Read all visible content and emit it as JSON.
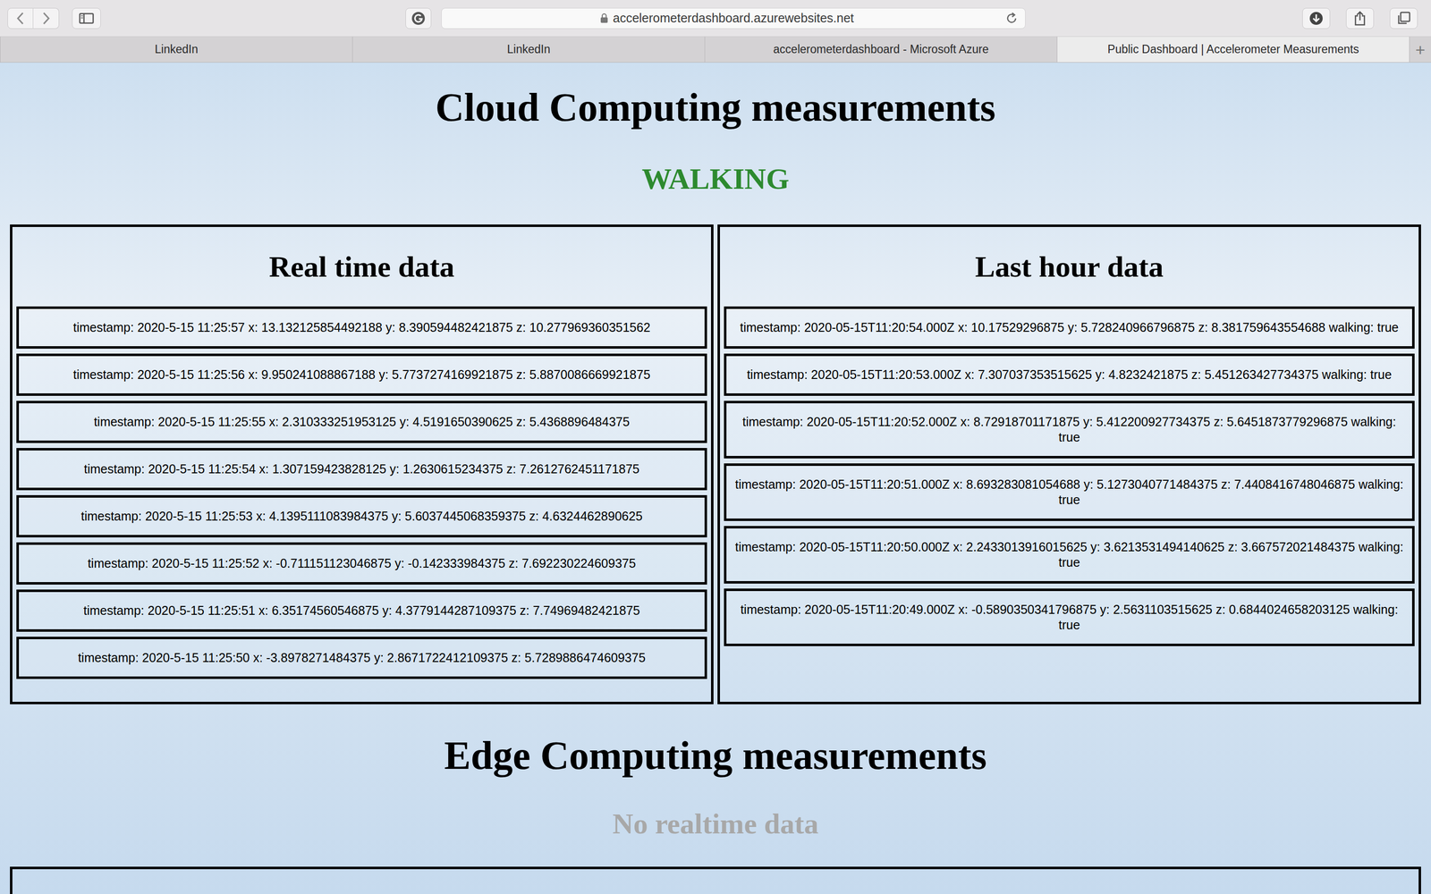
{
  "browser": {
    "address": "accelerometerdashboard.azurewebsites.net",
    "tabs": [
      {
        "label": "LinkedIn",
        "selected": false
      },
      {
        "label": "LinkedIn",
        "selected": false
      },
      {
        "label": "accelerometerdashboard - Microsoft Azure",
        "selected": false
      },
      {
        "label": "Public Dashboard | Accelerometer Measurements",
        "selected": true
      }
    ],
    "new_tab": "+"
  },
  "cloud": {
    "title": "Cloud Computing measurements",
    "status": "WALKING"
  },
  "realtime": {
    "title": "Real time data",
    "rows": [
      "timestamp: 2020-5-15 11:25:57 x: 13.132125854492188 y: 8.390594482421875 z: 10.277969360351562",
      "timestamp: 2020-5-15 11:25:56 x: 9.950241088867188 y: 5.7737274169921875 z: 5.8870086669921875",
      "timestamp: 2020-5-15 11:25:55 x: 2.310333251953125 y: 4.5191650390625 z: 5.4368896484375",
      "timestamp: 2020-5-15 11:25:54 x: 1.307159423828125 y: 1.2630615234375 z: 7.2612762451171875",
      "timestamp: 2020-5-15 11:25:53 x: 4.1395111083984375 y: 5.6037445068359375 z: 4.6324462890625",
      "timestamp: 2020-5-15 11:25:52 x: -0.711151123046875 y: -0.142333984375 z: 7.692230224609375",
      "timestamp: 2020-5-15 11:25:51 x: 6.35174560546875 y: 4.3779144287109375 z: 7.74969482421875",
      "timestamp: 2020-5-15 11:25:50 x: -3.8978271484375 y: 2.8671722412109375 z: 5.7289886474609375"
    ]
  },
  "last_hour": {
    "title": "Last hour data",
    "rows": [
      "timestamp: 2020-05-15T11:20:54.000Z x: 10.17529296875 y: 5.728240966796875 z: 8.381759643554688 walking: true",
      "timestamp: 2020-05-15T11:20:53.000Z x: 7.307037353515625 y: 4.8232421875 z: 5.451263427734375 walking: true",
      "timestamp: 2020-05-15T11:20:52.000Z x: 8.72918701171875 y: 5.412200927734375 z: 5.6451873779296875 walking: true",
      "timestamp: 2020-05-15T11:20:51.000Z x: 8.693283081054688 y: 5.1273040771484375 z: 7.4408416748046875 walking: true",
      "timestamp: 2020-05-15T11:20:50.000Z x: 2.2433013916015625 y: 3.6213531494140625 z: 3.667572021484375 walking: true",
      "timestamp: 2020-05-15T11:20:49.000Z x: -0.5890350341796875 y: 2.5631103515625 z: 0.6844024658203125 walking: true"
    ]
  },
  "edge": {
    "title": "Edge Computing measurements",
    "status": "No realtime data"
  }
}
